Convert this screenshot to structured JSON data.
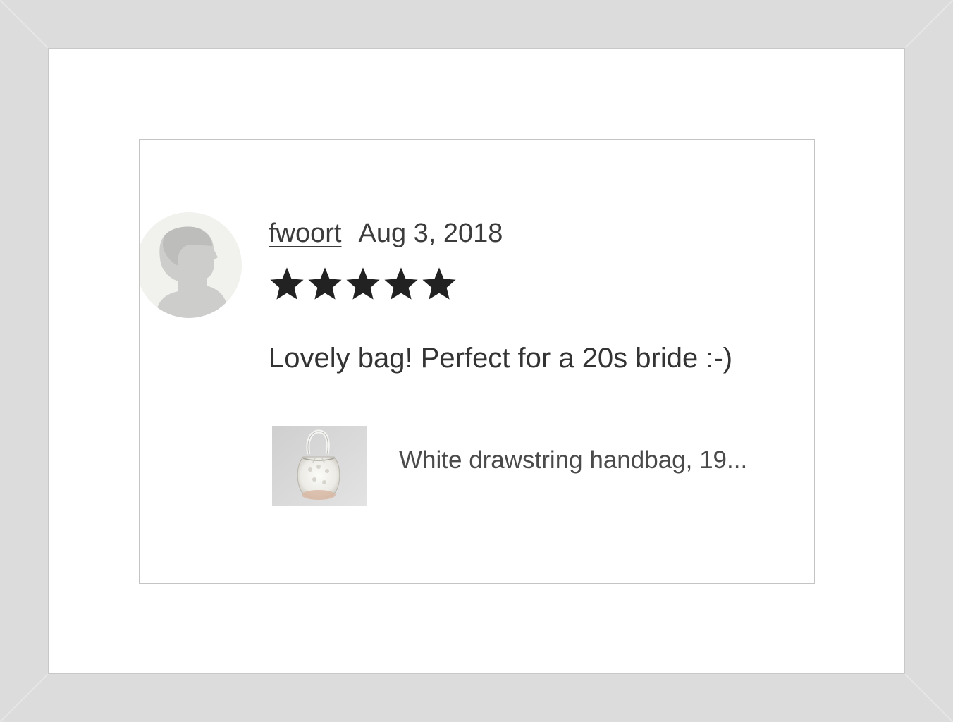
{
  "review": {
    "username": "fwoort",
    "date": "Aug 3, 2018",
    "rating": 5,
    "rating_max": 5,
    "text": "Lovely bag! Perfect for a 20s bride :-)"
  },
  "product": {
    "title": "White drawstring handbag, 19..."
  },
  "icons": {
    "avatar": "default-user-silhouette-icon",
    "star": "star-filled-icon"
  },
  "colors": {
    "frame": "#dcdcdc",
    "star": "#222222",
    "text": "#333333"
  }
}
